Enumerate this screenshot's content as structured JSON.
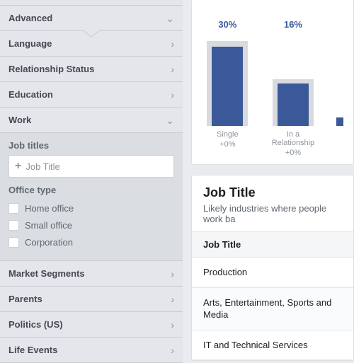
{
  "sidebar": {
    "advanced": "Advanced",
    "language": "Language",
    "relationship": "Relationship Status",
    "education": "Education",
    "work": "Work",
    "job_titles_label": "Job titles",
    "job_title_placeholder": "Job Title",
    "office_type_label": "Office type",
    "office_options": {
      "home": "Home office",
      "small": "Small office",
      "corp": "Corporation"
    },
    "market_segments": "Market Segments",
    "parents": "Parents",
    "politics": "Politics (US)",
    "life_events": "Life Events"
  },
  "chart_data": {
    "type": "bar",
    "categories": [
      "Single",
      "In a Relationship"
    ],
    "values": [
      30,
      16
    ],
    "deltas": [
      "+0%",
      "+0%"
    ],
    "title": "",
    "xlabel": "",
    "ylabel": "",
    "ylim": [
      0,
      35
    ]
  },
  "job_title_section": {
    "heading": "Job Title",
    "subheading": "Likely industries where people work ba",
    "col_header": "Job Title",
    "rows": [
      "Production",
      "Arts, Entertainment, Sports and Media",
      "IT and Technical Services"
    ]
  },
  "colors": {
    "brand": "#3b5998"
  }
}
